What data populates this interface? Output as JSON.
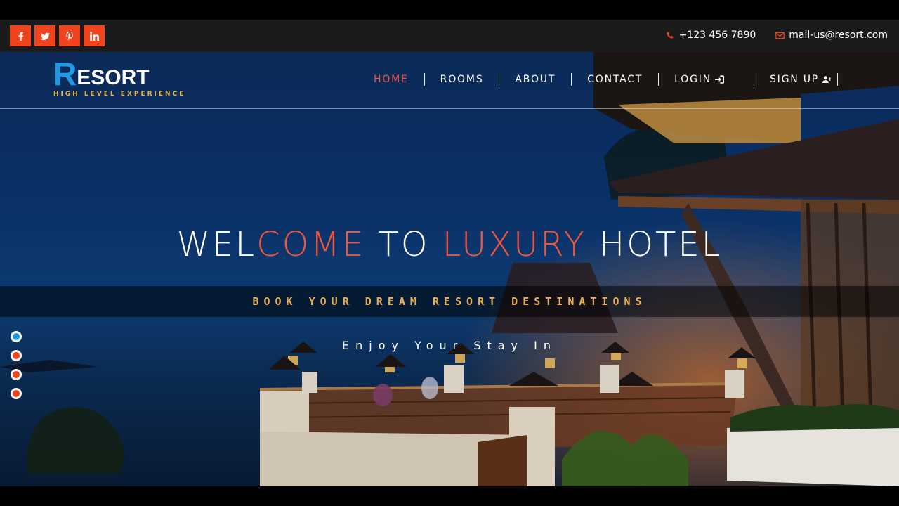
{
  "topbar": {
    "social": [
      {
        "icon": "facebook-icon",
        "glyph": "f"
      },
      {
        "icon": "twitter-icon",
        "glyph": "t"
      },
      {
        "icon": "pinterest-icon",
        "glyph": "p"
      },
      {
        "icon": "linkedin-icon",
        "glyph": "in"
      }
    ],
    "phone": "+123 456 7890",
    "email": "mail-us@resort.com",
    "accent_color": "#f0441f"
  },
  "logo": {
    "initial": "R",
    "rest": "ESORT",
    "tagline": "HIGH LEVEL EXPERIENCE"
  },
  "nav": {
    "home": "HOME",
    "rooms": "ROOMS",
    "about": "ABOUT",
    "contact": "CONTACT",
    "login": "LOGIN",
    "signup": "SIGN UP"
  },
  "hero": {
    "headline": {
      "part1": "WEL",
      "part2": "COME",
      "part3": " TO ",
      "part4": "LUXURY",
      "part5": " HOTEL"
    },
    "band_text": "BOOK YOUR DREAM RESORT DESTINATIONS",
    "tagline": "Enjoy Your Stay In",
    "slides": [
      {
        "active": true,
        "color": "#1e9be4"
      },
      {
        "active": false,
        "color": "#f0441f"
      },
      {
        "active": false,
        "color": "#f0441f"
      },
      {
        "active": false,
        "color": "#f0441f"
      }
    ]
  }
}
